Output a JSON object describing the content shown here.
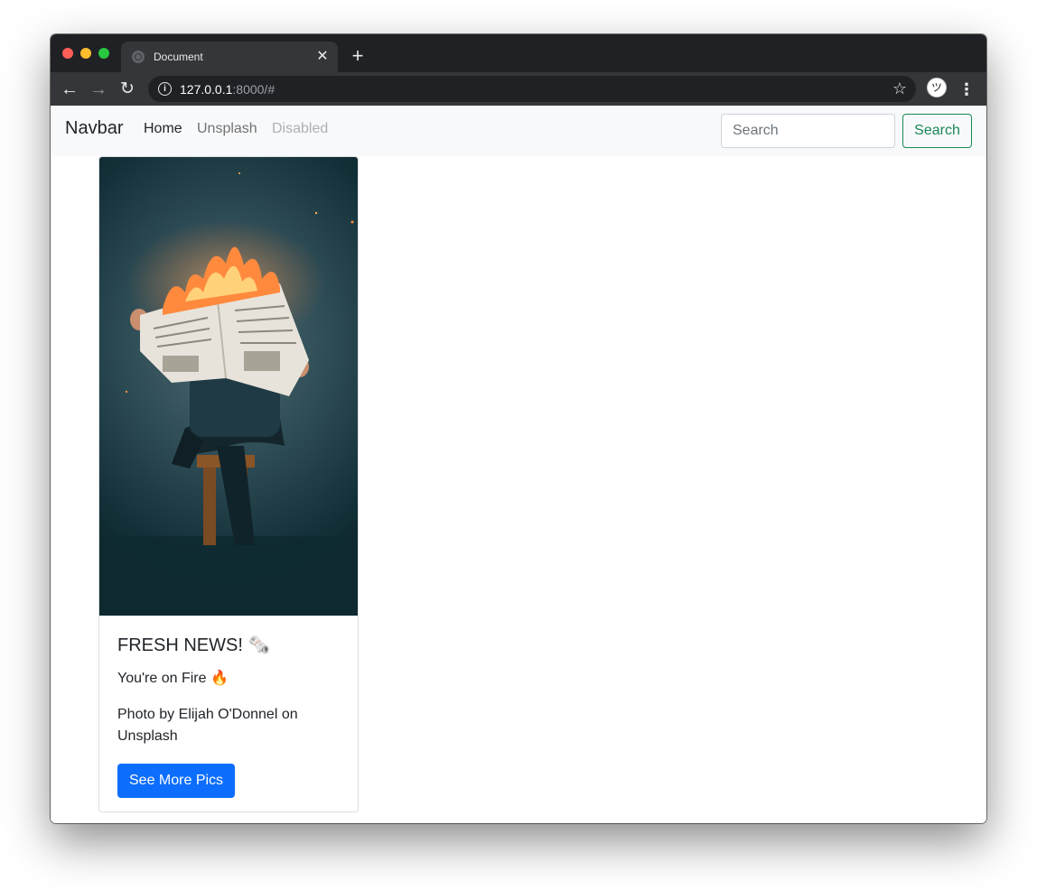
{
  "browser": {
    "tab_title": "Document",
    "tab_close": "✕",
    "new_tab": "+",
    "url_host": "127.0.0.1",
    "url_rest": ":8000/#",
    "back": "←",
    "forward": "→",
    "reload": "↻",
    "info": "i",
    "star": "☆",
    "menu": "⋮",
    "avatar": "ツ"
  },
  "navbar": {
    "brand": "Navbar",
    "links": [
      {
        "label": "Home",
        "state": "active"
      },
      {
        "label": "Unsplash",
        "state": "normal"
      },
      {
        "label": "Disabled",
        "state": "disabled"
      }
    ],
    "search": {
      "placeholder": "Search",
      "value": "",
      "button_label": "Search"
    }
  },
  "card": {
    "title": "FRESH NEWS! 🗞️",
    "subtitle": "You're on Fire 🔥",
    "caption": "Photo by Elijah O'Donnel on Unsplash",
    "button_label": "See More Pics"
  },
  "colors": {
    "primary": "#0d6efd",
    "success": "#198754",
    "navbar_bg": "#f8f9fa",
    "chrome_dark": "#202124",
    "chrome_toolbar": "#35363a"
  }
}
